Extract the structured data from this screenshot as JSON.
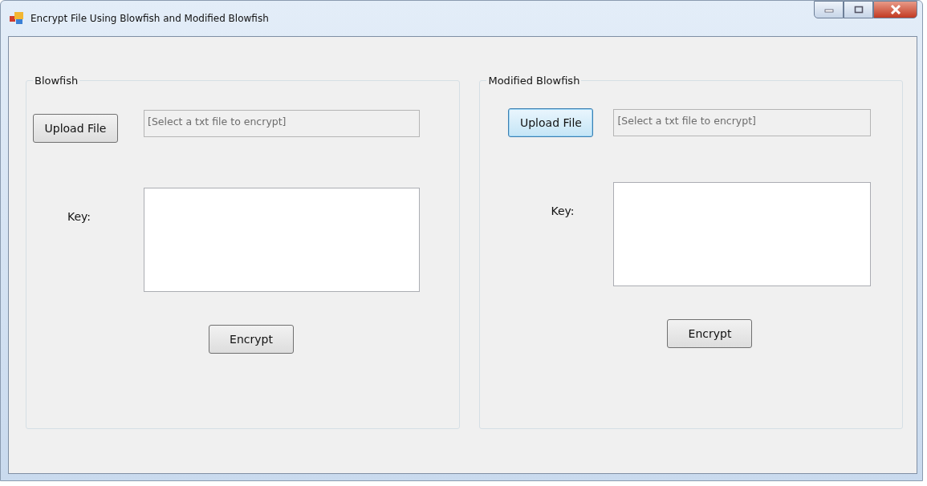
{
  "window": {
    "title": "Encrypt File Using Blowfish and Modified Blowfish"
  },
  "groups": [
    {
      "title": "Blowfish",
      "upload_button": {
        "label": "Upload File",
        "focused": false
      },
      "file_field": {
        "value": "[Select a txt file to encrypt]"
      },
      "key_label": "Key:",
      "encrypt_button": {
        "label": "Encrypt"
      }
    },
    {
      "title": "Modified Blowfish",
      "upload_button": {
        "label": "Upload File",
        "focused": true
      },
      "file_field": {
        "value": "[Select a txt file to encrypt]"
      },
      "key_label": "Key:",
      "encrypt_button": {
        "label": "Encrypt"
      }
    }
  ]
}
